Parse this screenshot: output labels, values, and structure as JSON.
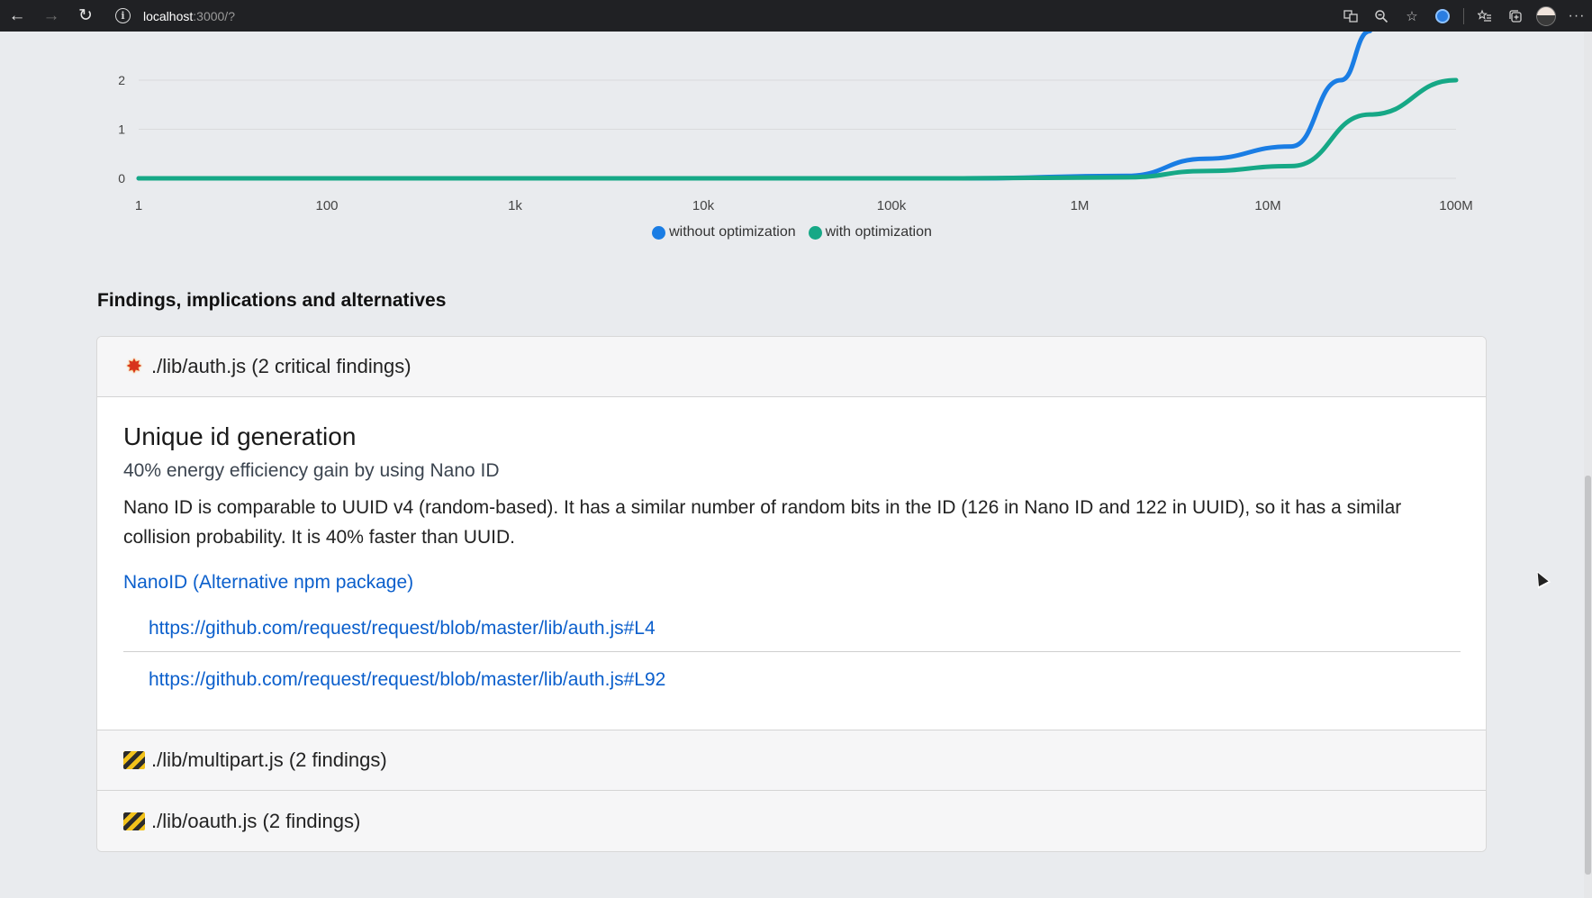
{
  "browser": {
    "back_icon": "←",
    "forward_icon": "→",
    "reload_icon": "↻",
    "url_host": "localhost",
    "url_path": ":3000/?",
    "right_icons": [
      "translate-icon",
      "zoom-icon",
      "star-icon",
      "extension-icon",
      "favorites-icon",
      "collections-icon",
      "profile-icon",
      "more-icon"
    ]
  },
  "chart_data": {
    "type": "line",
    "x": [
      "1",
      "100",
      "1k",
      "10k",
      "100k",
      "1M",
      "10M",
      "100M"
    ],
    "x_scale": "log",
    "y_ticks": [
      "0",
      "1",
      "2"
    ],
    "ylim": [
      0,
      3
    ],
    "series": [
      {
        "name": "without optimization",
        "color": "#1a7de4",
        "points": [
          [
            1,
            0
          ],
          [
            100,
            0
          ],
          [
            1000,
            0
          ],
          [
            10000,
            0
          ],
          [
            100000,
            0
          ],
          [
            1000000,
            0.05
          ],
          [
            3000000,
            0.4
          ],
          [
            10000000,
            0.65
          ],
          [
            20000000,
            2.0
          ],
          [
            30000000,
            3.0
          ]
        ]
      },
      {
        "name": "with optimization",
        "color": "#16a886",
        "points": [
          [
            1,
            0
          ],
          [
            100,
            0
          ],
          [
            1000,
            0
          ],
          [
            10000,
            0
          ],
          [
            100000,
            0
          ],
          [
            1000000,
            0.02
          ],
          [
            3000000,
            0.15
          ],
          [
            10000000,
            0.25
          ],
          [
            30000000,
            1.3
          ],
          [
            100000000,
            2.0
          ]
        ]
      }
    ],
    "legend_position": "bottom"
  },
  "findings": {
    "title": "Findings, implications and alternatives",
    "groups": [
      {
        "icon": "collision-icon",
        "label": "./lib/auth.js (2 critical findings)",
        "expanded": true,
        "title": "Unique id generation",
        "subtitle": "40% energy efficiency gain by using Nano ID",
        "description": "Nano ID is comparable to UUID v4 (random-based). It has a similar number of random bits in the ID (126 in Nano ID and 122 in UUID), so it has a similar collision probability. It is 40% faster than UUID.",
        "package_link": "NanoID (Alternative npm package)",
        "references": [
          "https://github.com/request/request/blob/master/lib/auth.js#L4",
          "https://github.com/request/request/blob/master/lib/auth.js#L92"
        ]
      },
      {
        "icon": "construction-icon",
        "label": "./lib/multipart.js (2 findings)",
        "expanded": false
      },
      {
        "icon": "construction-icon",
        "label": "./lib/oauth.js (2 findings)",
        "expanded": false
      }
    ]
  }
}
